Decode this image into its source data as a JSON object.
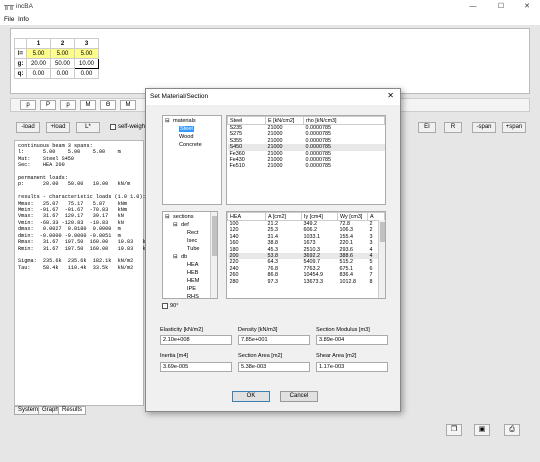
{
  "app": {
    "title": "incBA",
    "icon": "app-icon"
  },
  "menu": {
    "file": "File",
    "info": "Info"
  },
  "spans": {
    "headers": [
      "1",
      "2",
      "3"
    ],
    "rows": [
      {
        "label": "l=",
        "values": [
          "5.00",
          "5.00",
          "5.00"
        ]
      },
      {
        "label": "g:",
        "values": [
          "20.00",
          "50.00",
          "10.00"
        ]
      },
      {
        "label": "q:",
        "values": [
          "0.00",
          "0.00",
          "0.00"
        ]
      }
    ]
  },
  "toolbar": [
    "p",
    "P",
    "p",
    "M",
    "Θ",
    "M"
  ],
  "buttons": {
    "load_left": "-load",
    "load_plus": "+load",
    "lstar": "L*",
    "selfweight": "self-weight",
    "ei": "EI",
    "r": "R",
    "span_minus": "-span",
    "span_plus": "+span"
  },
  "results_text": "continuous beam 3 spans:\nl:      5.00    5.00    5.00    m\nMat:    Steel S450\nSec:    HEA 200\n\npermanent loads:\np:      20.00   50.00   10.00   kN/m\n\nresults - characteristic loads (1.0 1.0):\nMmax:   25.07   75.17   5.87    kNm\nMmin:  -91.67  -91.67  -70.83   kNm\nVmax:   31.67  129.17   39.17   kN\nVmin:  -68.33 -120.83  -10.83   kN\ndmax:   0.0027  0.0180  0.0000  m\ndmin:  -0.0000 -0.0000 -0.0051  m\nRmax:   31.67  197.50  160.00   10.83   kN\nRmin:   31.67  197.50  160.00   10.83   kN\n\nSigma:  235.6k  235.6k  182.1k  kN/m2\nTau:    58.4k   110.4k  33.5k   kN/m2",
  "tabs": [
    "System",
    "Graph",
    "Results"
  ],
  "dialog": {
    "title": "Set Material/Section",
    "close": "✕",
    "materials_tree": {
      "root": "materials",
      "items": [
        "Steel",
        "Wood",
        "Concrete"
      ],
      "selected": "Steel"
    },
    "materials_table": {
      "headers": [
        "Steel",
        "E [kN/cm2]",
        "rho [kN/cm3]"
      ],
      "rows": [
        [
          "S235",
          "21000",
          "0.0000785"
        ],
        [
          "S275",
          "21000",
          "0.0000785"
        ],
        [
          "S355",
          "21000",
          "0.0000785"
        ],
        [
          "S450",
          "21000",
          "0.0000785"
        ],
        [
          "Fe360",
          "21000",
          "0.0000785"
        ],
        [
          "Fe430",
          "21000",
          "0.0000785"
        ],
        [
          "Fe510",
          "21000",
          "0.0000785"
        ]
      ],
      "highlight_row": 3
    },
    "sections_tree": {
      "root": "sections",
      "def": "def",
      "def_items": [
        "Rect",
        "Isec",
        "Tube"
      ],
      "db": "db",
      "db_items": [
        "HEA",
        "HEB",
        "HEM",
        "IPE",
        "RHS"
      ]
    },
    "sections_table": {
      "headers": [
        "HEA",
        "A [cm2]",
        "Iy [cm4]",
        "Wy [cm3]",
        "A"
      ],
      "rows": [
        [
          "100",
          "21.2",
          "349.2",
          "72.8",
          "2"
        ],
        [
          "120",
          "25.3",
          "606.2",
          "106.3",
          "2"
        ],
        [
          "140",
          "31.4",
          "1033.1",
          "155.4",
          "3"
        ],
        [
          "160",
          "38.8",
          "1673",
          "220.1",
          "3"
        ],
        [
          "180",
          "45.3",
          "2510.3",
          "293.6",
          "4"
        ],
        [
          "200",
          "53.8",
          "3692.2",
          "388.6",
          "4"
        ],
        [
          "220",
          "64.3",
          "5409.7",
          "515.2",
          "5"
        ],
        [
          "240",
          "76.8",
          "7763.2",
          "675.1",
          "6"
        ],
        [
          "260",
          "86.8",
          "10454.9",
          "836.4",
          "7"
        ],
        [
          "280",
          "97.3",
          "13673.3",
          "1012.8",
          "8"
        ]
      ],
      "highlight_row": 5
    },
    "rotate_label": "90°",
    "props": {
      "elasticity_label": "Elasticity [kN/m2]",
      "elasticity": "2.10e+008",
      "density_label": "Density [kN/m3]",
      "density": "7.85e+001",
      "section_modulus_label": "Section Modulus [m3]",
      "section_modulus": "3.89e-004",
      "inertia_label": "Inertia [m4]",
      "inertia": "3.69e-005",
      "section_area_label": "Section Area [m2]",
      "section_area": "5.38e-003",
      "shear_area_label": "Shear Area [m2]",
      "shear_area": "1.17e-003"
    },
    "ok": "OK",
    "cancel": "Cancel"
  }
}
